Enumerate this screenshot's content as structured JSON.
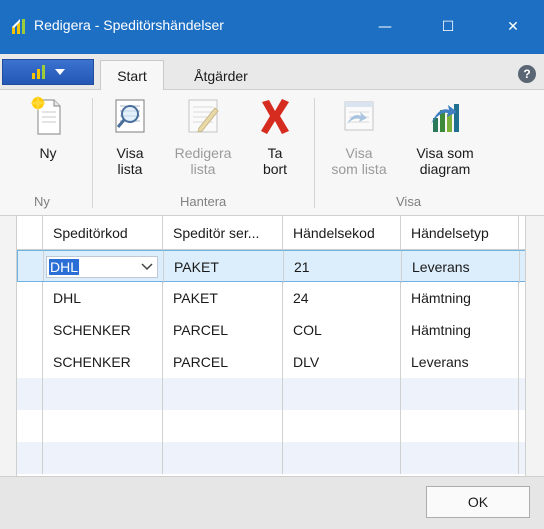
{
  "window": {
    "title": "Redigera - Speditörshändelser",
    "min_glyph": "—",
    "max_glyph": "☐",
    "close_glyph": "✕"
  },
  "ribbon_tabs": {
    "start": "Start",
    "actions": "Åtgärder",
    "help": "?"
  },
  "ribbon": {
    "new_line1": "Ny",
    "new_line2": "",
    "view_list_line1": "Visa",
    "view_list_line2": "lista",
    "edit_list_line1": "Redigera",
    "edit_list_line2": "lista",
    "delete_line1": "Ta",
    "delete_line2": "bort",
    "show_as_list_line1": "Visa",
    "show_as_list_line2": "som lista",
    "show_as_chart_line1": "Visa som",
    "show_as_chart_line2": "diagram",
    "group_new": "Ny",
    "group_manage": "Hantera",
    "group_view": "Visa"
  },
  "grid": {
    "columns": [
      "Speditörkod",
      "Speditör ser...",
      "Händelsekod",
      "Händelsetyp"
    ],
    "rows": [
      [
        "DHL",
        "PAKET",
        "21",
        "Leverans"
      ],
      [
        "DHL",
        "PAKET",
        "24",
        "Hämtning"
      ],
      [
        "SCHENKER",
        "PARCEL",
        "COL",
        "Hämtning"
      ],
      [
        "SCHENKER",
        "PARCEL",
        "DLV",
        "Leverans"
      ]
    ]
  },
  "footer": {
    "ok_label": "OK"
  },
  "colors": {
    "titlebar": "#1d6fc4",
    "selection": "#dceefb",
    "alt_row": "#eef3fb"
  }
}
